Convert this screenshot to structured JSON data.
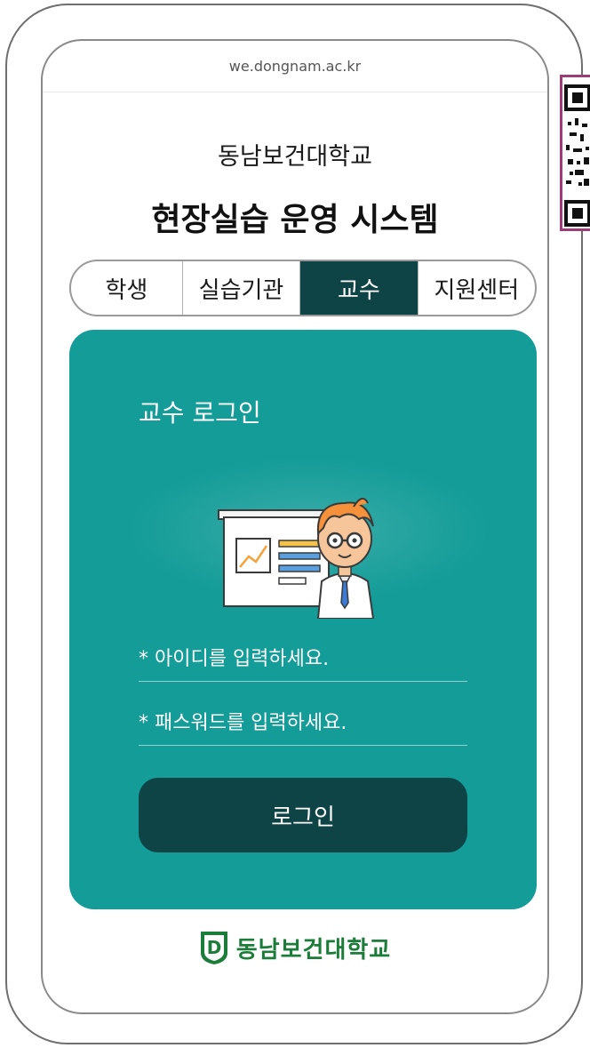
{
  "browser": {
    "url": "we.dongnam.ac.kr"
  },
  "header": {
    "school_name": "동남보건대학교",
    "system_title": "현장실습 운영 시스템"
  },
  "tabs": [
    {
      "label": "학생",
      "active": false
    },
    {
      "label": "실습기관",
      "active": false
    },
    {
      "label": "교수",
      "active": true
    },
    {
      "label": "지원센터",
      "active": false
    }
  ],
  "login": {
    "title": "교수 로그인",
    "id_placeholder": "* 아이디를 입력하세요.",
    "pw_placeholder": "* 패스워드를 입력하세요.",
    "button_label": "로그인"
  },
  "footer": {
    "logo_text": "동남보건대학교",
    "emblem_letter": "D"
  },
  "colors": {
    "accent_teal": "#139c98",
    "dark_teal": "#0e4445",
    "logo_green": "#1c7d3a",
    "qr_border": "#9b3d77"
  },
  "icons": [
    "professor-illustration",
    "qr-code-icon",
    "school-emblem-icon"
  ]
}
